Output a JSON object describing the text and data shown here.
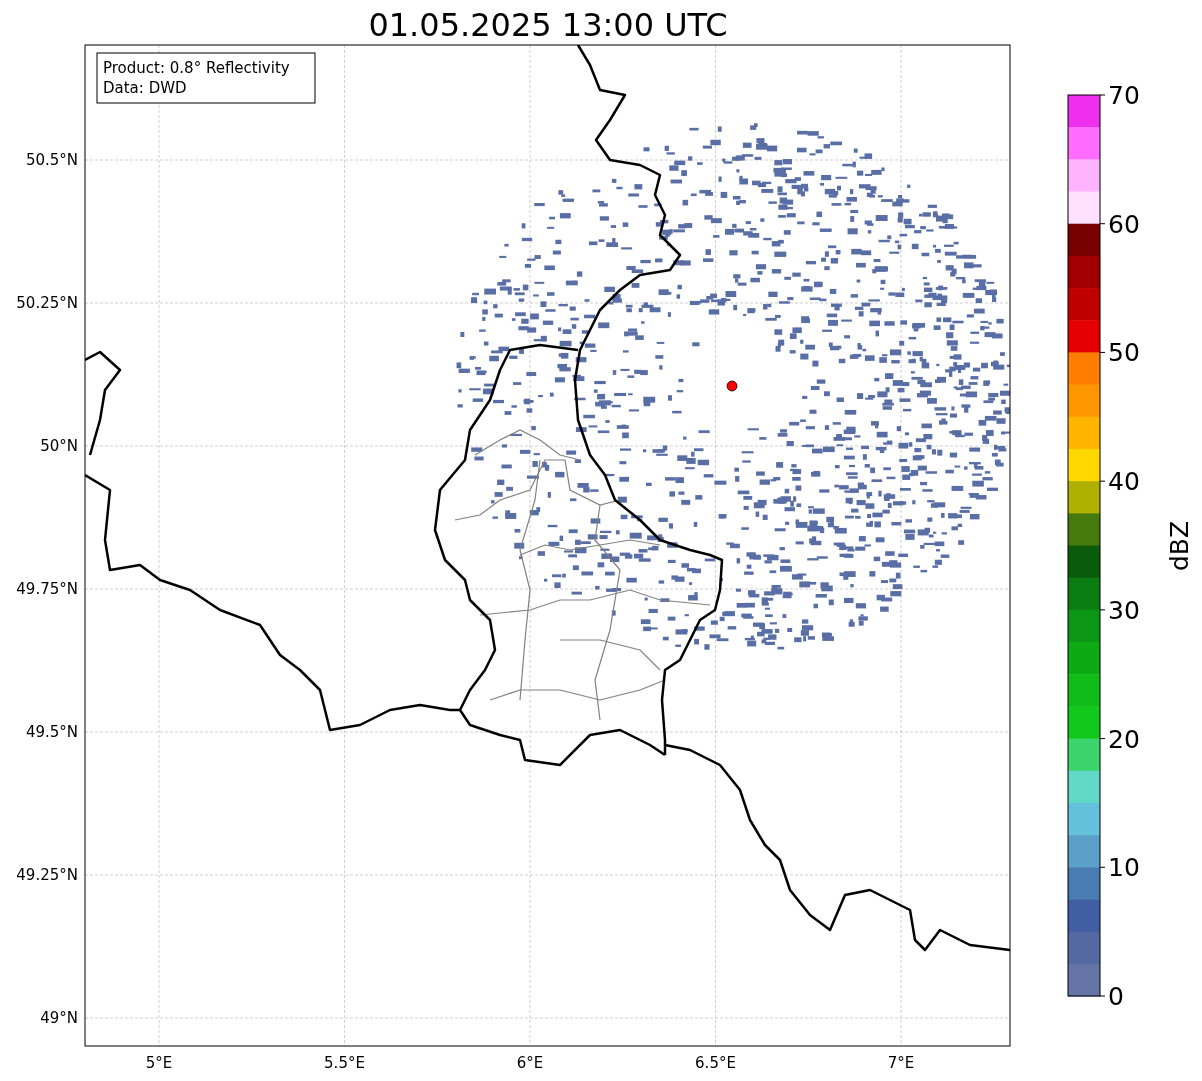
{
  "title": "01.05.2025 13:00 UTC",
  "legend": {
    "lines": [
      "Product: 0.8° Reflectivity",
      "Data: DWD"
    ]
  },
  "lat_ticks": [
    "50.5°N",
    "50.25°N",
    "50°N",
    "49.75°N",
    "49.5°N",
    "49.25°N",
    "49°N"
  ],
  "lon_ticks": [
    "5°E",
    "5.5°E",
    "6°E",
    "6.5°E",
    "7°E"
  ],
  "colorbar": {
    "label": "dBZ",
    "ticks": [
      "70",
      "60",
      "50",
      "40",
      "30",
      "20",
      "10",
      "0"
    ],
    "bins": [
      {
        "color": "#ee30ee"
      },
      {
        "color": "#ff6cff"
      },
      {
        "color": "#ffb4ff"
      },
      {
        "color": "#ffe0ff"
      },
      {
        "color": "#780000"
      },
      {
        "color": "#a00000"
      },
      {
        "color": "#c00000"
      },
      {
        "color": "#e40000"
      },
      {
        "color": "#ff7e00"
      },
      {
        "color": "#ff9800"
      },
      {
        "color": "#ffb400"
      },
      {
        "color": "#ffd800"
      },
      {
        "color": "#b0b000"
      },
      {
        "color": "#467a0c"
      },
      {
        "color": "#0a5c0a"
      },
      {
        "color": "#0a7e12"
      },
      {
        "color": "#0c9616"
      },
      {
        "color": "#0eaa14"
      },
      {
        "color": "#10bc18"
      },
      {
        "color": "#12c81a"
      },
      {
        "color": "#3cd46c"
      },
      {
        "color": "#62d8c6"
      },
      {
        "color": "#66c2dc"
      },
      {
        "color": "#5aa0c8"
      },
      {
        "color": "#4a7cb4"
      },
      {
        "color": "#425ea2"
      },
      {
        "color": "#5468a2"
      },
      {
        "color": "#6474a6"
      }
    ]
  }
}
